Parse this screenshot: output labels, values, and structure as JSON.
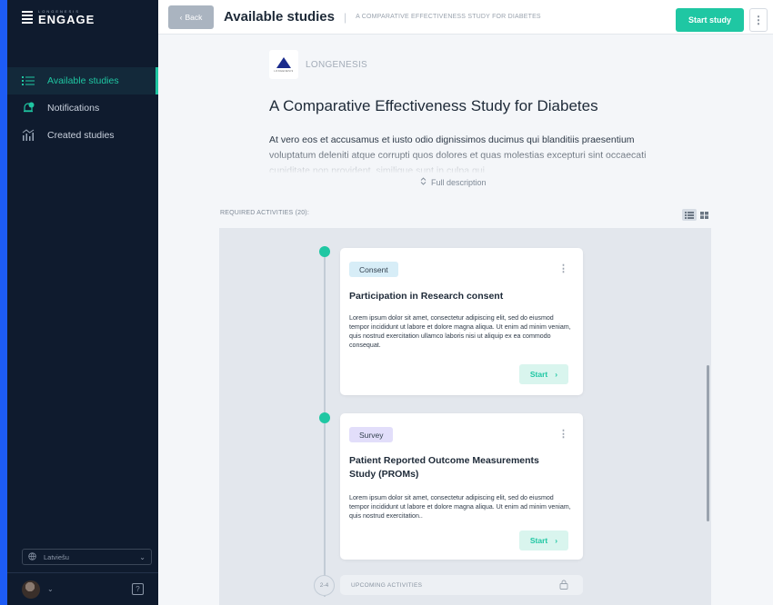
{
  "sidebar": {
    "brand_sub": "LONGENESIS",
    "brand_main": "ENGAGE",
    "items": [
      {
        "label": "Available studies",
        "icon": "list-icon",
        "active": true
      },
      {
        "label": "Notifications",
        "icon": "bell-icon",
        "badge": "1"
      },
      {
        "label": "Created studies",
        "icon": "stats-icon"
      }
    ],
    "language": "Latviešu",
    "help": "?"
  },
  "topbar": {
    "back_label": "Back",
    "title": "Available studies",
    "subtitle": "A COMPARATIVE EFFECTIVENESS STUDY FOR DIABETES",
    "start_label": "Start study",
    "menu": "⋮"
  },
  "study": {
    "org_name": "LONGENESIS",
    "org_logo_text": "LONGENESIS",
    "title": "A Comparative Effectiveness Study for Diabetes",
    "description": "At vero eos et accusamus et iusto odio dignissimos ducimus qui blanditiis praesentium voluptatum deleniti atque corrupti quos dolores et quas molestias excepturi sint occaecati cupiditate non provident, similique sunt in culpa qui",
    "full_description_label": "Full description"
  },
  "activities": {
    "label": "REQUIRED ACTIVITIES (20):",
    "cards": [
      {
        "tag": "Consent",
        "title": "Participation in Research consent",
        "body": "Lorem ipsum dolor sit amet, consectetur adipiscing elit, sed do eiusmod tempor incididunt ut labore et dolore magna aliqua. Ut enim ad minim veniam, quis nostrud exercitation ullamco laboris nisi ut aliquip ex ea commodo consequat.",
        "start_label": "Start"
      },
      {
        "tag": "Survey",
        "title": "Patient Reported Outcome Measurements Study (PROMs)",
        "body": "Lorem ipsum dolor sit amet, consectetur adipiscing elit, sed do eiusmod tempor incididunt ut labore et dolore magna aliqua. Ut enim ad minim veniam, quis nostrud exercitation..",
        "start_label": "Start"
      }
    ],
    "upcoming_step": "2-4",
    "upcoming_label": "UPCOMING ACTIVITIES"
  },
  "colors": {
    "accent": "#1fc7a3",
    "sidebar_bg": "#0f1b2e",
    "frame": "#1d5cf5"
  }
}
